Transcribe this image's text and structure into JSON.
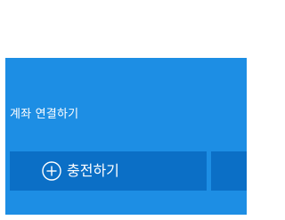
{
  "panel": {
    "account_link_label": "계좌 연결하기",
    "charge_button_label": "충전하기"
  },
  "colors": {
    "panel_background": "#1d8ee4",
    "button_background": "#0b6fc6",
    "text": "#ffffff"
  },
  "icons": {
    "charge_button_icon": "plus-circle-icon"
  }
}
